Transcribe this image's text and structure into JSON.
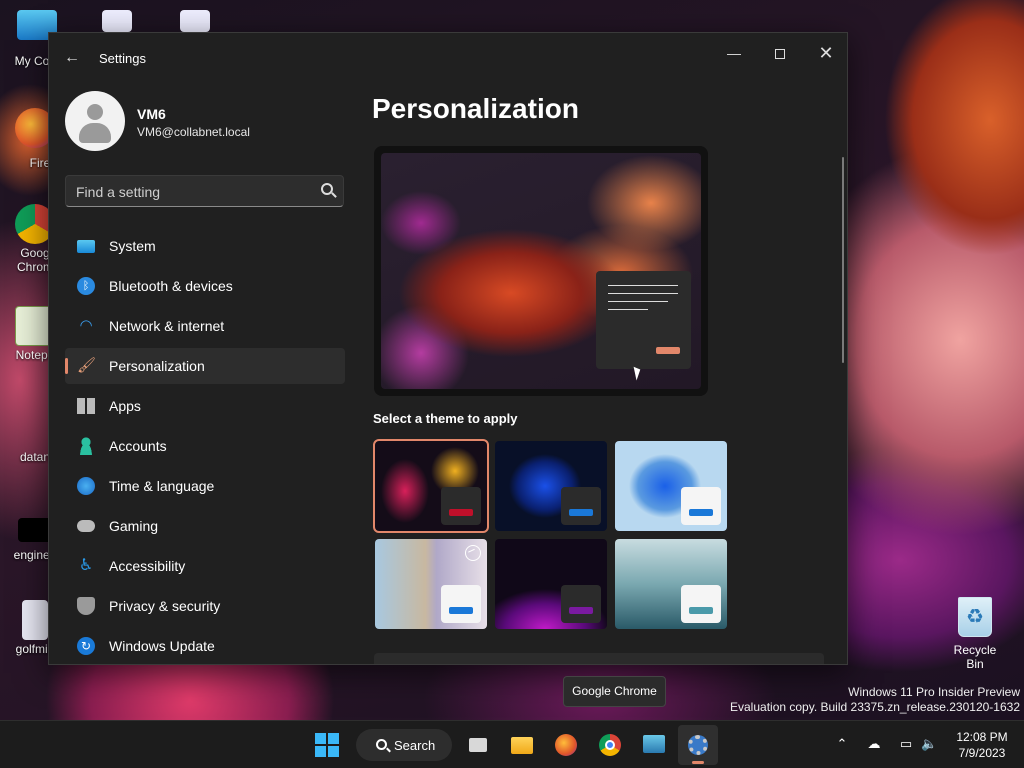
{
  "desktop": {
    "icons": [
      {
        "label": "My Com",
        "color": "#2ea0e0"
      },
      {
        "label": "Firefo",
        "color": "#e0662a"
      },
      {
        "label": "Goog Chrom",
        "color": "#2a8ad8"
      },
      {
        "label": "Notepa",
        "color": "#7ab04a"
      },
      {
        "label": "datan",
        "color": "#888888"
      },
      {
        "label": "enginee",
        "color": "#000000"
      },
      {
        "label": "golfmin",
        "color": "#d8d8e8"
      }
    ],
    "recycle_bin_label": "Recycle Bin",
    "watermark_line1": "Windows 11 Pro Insider Preview",
    "watermark_line2": "Evaluation copy. Build 23375.zn_release.230120-1632"
  },
  "window": {
    "title": "Settings",
    "back_icon": "back-arrow-icon",
    "controls": [
      "minimize",
      "maximize",
      "close"
    ]
  },
  "profile": {
    "name": "VM6",
    "email": "VM6@collabnet.local"
  },
  "search": {
    "placeholder": "Find a setting"
  },
  "nav": {
    "items": [
      {
        "label": "System",
        "icon": "monitor-icon"
      },
      {
        "label": "Bluetooth & devices",
        "icon": "bluetooth-icon"
      },
      {
        "label": "Network & internet",
        "icon": "wifi-icon"
      },
      {
        "label": "Personalization",
        "icon": "brush-icon",
        "active": true
      },
      {
        "label": "Apps",
        "icon": "apps-icon"
      },
      {
        "label": "Accounts",
        "icon": "person-icon"
      },
      {
        "label": "Time & language",
        "icon": "globe-clock-icon"
      },
      {
        "label": "Gaming",
        "icon": "gamepad-icon"
      },
      {
        "label": "Accessibility",
        "icon": "accessibility-icon"
      },
      {
        "label": "Privacy & security",
        "icon": "shield-icon"
      },
      {
        "label": "Windows Update",
        "icon": "update-icon"
      }
    ]
  },
  "content": {
    "title": "Personalization",
    "theme_heading": "Select a theme to apply",
    "themes": [
      {
        "name": "theme-1",
        "accent": "#c0102a",
        "swatch_bg": "#2b2b2b",
        "selected": true
      },
      {
        "name": "theme-2",
        "accent": "#1a78d8",
        "swatch_bg": "#2b2b2b"
      },
      {
        "name": "theme-3",
        "accent": "#1a78d8",
        "swatch_bg": "#f5f5f5"
      },
      {
        "name": "theme-4",
        "accent": "#1a78d8",
        "swatch_bg": "#f5f5f5"
      },
      {
        "name": "theme-5",
        "accent": "#7a1aa0",
        "swatch_bg": "#2b2b2b"
      },
      {
        "name": "theme-6",
        "accent": "#4a9aaa",
        "swatch_bg": "#f5f5f5"
      }
    ]
  },
  "tooltip": "Google Chrome",
  "taskbar": {
    "search_label": "Search",
    "apps": [
      "start-icon",
      "task-view-icon",
      "file-explorer-icon",
      "firefox-icon",
      "chrome-icon",
      "notepad-app-icon",
      "settings-icon"
    ],
    "time": "12:08 PM",
    "date": "7/9/2023"
  }
}
